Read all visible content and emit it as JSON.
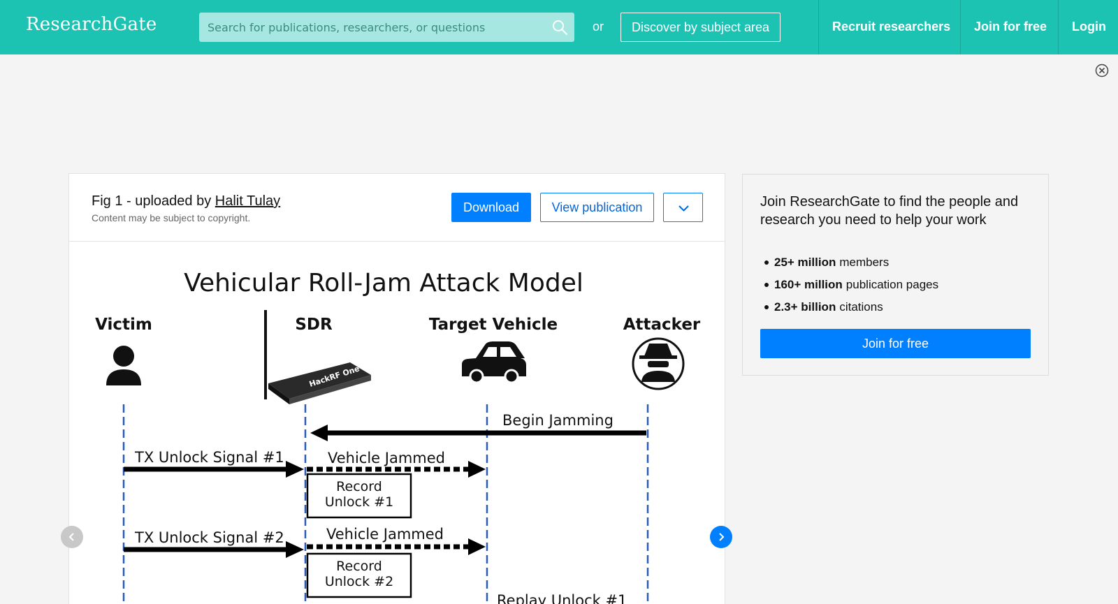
{
  "header": {
    "logo": "ResearchGate",
    "search_placeholder": "Search for publications, researchers, or questions",
    "or_text": "or",
    "discover_label": "Discover by subject area",
    "nav": {
      "recruit": "Recruit researchers",
      "join": "Join for free",
      "login": "Login"
    },
    "brand_color": "#1cc3b2"
  },
  "figure_card": {
    "title_prefix": "Fig 1 - uploaded by",
    "author": "Halit Tulay",
    "copyright": "Content may be subject to copyright.",
    "download_label": "Download",
    "view_label": "View publication",
    "accent_color": "#0080ff"
  },
  "figure": {
    "title": "Vehicular Roll-Jam Attack Model",
    "actors": [
      "Victim",
      "SDR",
      "Target Vehicle",
      "Attacker"
    ],
    "device_label": "HackRF One",
    "messages": {
      "begin_jamming": "Begin Jamming",
      "tx1": "TX Unlock Signal #1",
      "jammed1": "Vehicle Jammed",
      "record1_line1": "Record",
      "record1_line2": "Unlock #1",
      "tx2": "TX Unlock Signal #2",
      "jammed2": "Vehicle Jammed",
      "record2_line1": "Record",
      "record2_line2": "Unlock #2",
      "replay1": "Replay Unlock #1"
    }
  },
  "join_panel": {
    "text": "Join ResearchGate to find the people and research you need to help your work",
    "stats": [
      {
        "bold": "25+ million",
        "rest": "members"
      },
      {
        "bold": "160+ million",
        "rest": "publication pages"
      },
      {
        "bold": "2.3+ billion",
        "rest": "citations"
      }
    ],
    "button": "Join for free"
  },
  "icons": {
    "search": "search-icon",
    "close": "close-circle-icon",
    "chevron_down": "chevron-down-icon",
    "prev": "chevron-left-icon",
    "next": "chevron-right-icon"
  }
}
